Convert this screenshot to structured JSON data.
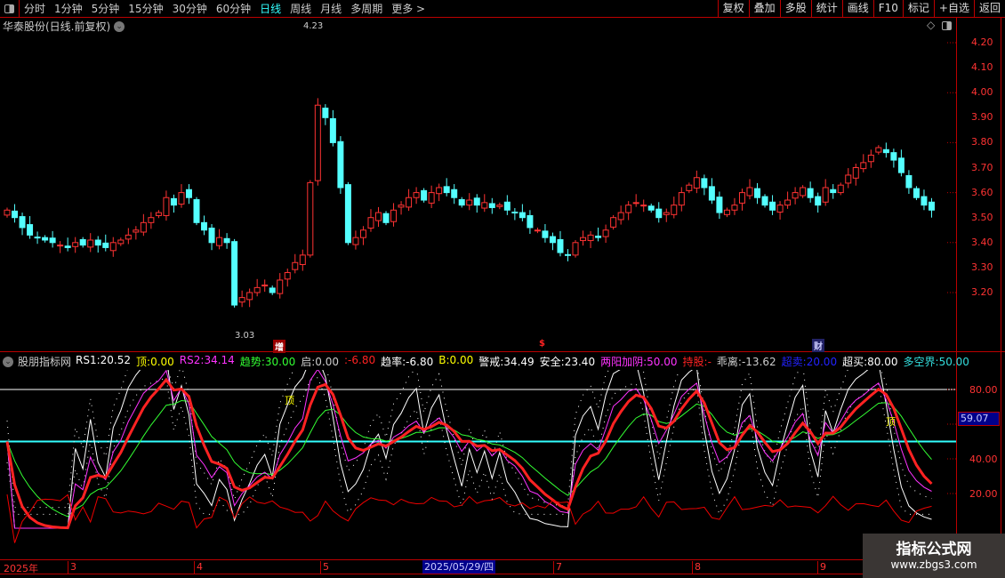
{
  "toolbar": {
    "periods": [
      "分时",
      "1分钟",
      "5分钟",
      "15分钟",
      "30分钟",
      "60分钟",
      "日线",
      "周线",
      "月线",
      "多周期",
      "更多 >"
    ],
    "active": "日线",
    "actions": [
      "复权",
      "叠加",
      "多股",
      "统计",
      "画线",
      "F10",
      "标记",
      "+自选",
      "返回"
    ]
  },
  "title": "华泰股份(日线.前复权)",
  "price_axis": [
    "4.20",
    "4.10",
    "4.00",
    "3.90",
    "3.80",
    "3.70",
    "3.60",
    "3.50",
    "3.40",
    "3.30",
    "3.20"
  ],
  "annotations": {
    "high": "4.23",
    "low": "3.03",
    "mark1": "增",
    "mark2": "$",
    "mark3": "财"
  },
  "indicator": {
    "name": "股朋指标网",
    "fields": [
      {
        "label": "RS1",
        "value": "20.52",
        "color": "#ffffff"
      },
      {
        "label": "顶",
        "value": "0.00",
        "color": "#ffff00"
      },
      {
        "label": "RS2",
        "value": "34.14",
        "color": "#ff33ff"
      },
      {
        "label": "趋势",
        "value": "30.00",
        "color": "#33ff33"
      },
      {
        "label": "启",
        "value": "0.00",
        "color": "#cccccc"
      },
      {
        "label": "",
        "value": "-6.80",
        "color": "#ff2222"
      },
      {
        "label": "趋率",
        "value": "-6.80",
        "color": "#ffffff"
      },
      {
        "label": "B",
        "value": "0.00",
        "color": "#ffff00"
      },
      {
        "label": "警戒",
        "value": "34.49",
        "color": "#ffffff"
      },
      {
        "label": "安全",
        "value": "23.40",
        "color": "#ffffff"
      },
      {
        "label": "两阳加阴",
        "value": "50.00",
        "color": "#ff33ff"
      },
      {
        "label": "持股",
        "value": "-",
        "color": "#ff2222"
      },
      {
        "label": "乖离",
        "value": "-13.62",
        "color": "#cccccc"
      },
      {
        "label": "超卖",
        "value": "20.00",
        "color": "#2222ff"
      },
      {
        "label": "超买",
        "value": "80.00",
        "color": "#ffffff"
      },
      {
        "label": "多空界",
        "value": "50.00",
        "color": "#33dddd"
      }
    ],
    "axis": [
      "80.00",
      "40.00",
      "20.00"
    ],
    "current": "59.07",
    "top_mark": "顶"
  },
  "dates": {
    "year": "2025年",
    "months": [
      "3",
      "4",
      "5",
      "7",
      "8",
      "9"
    ],
    "cursor": "2025/05/29/四"
  },
  "watermark": {
    "line1": "指标公式网",
    "line2": "www.zbgs3.com"
  },
  "colors": {
    "up": "#ff3333",
    "down": "#54ffff",
    "grid": "#bb0000"
  },
  "chart_data": {
    "type": "candlestick",
    "closes": [
      3.53,
      3.5,
      3.46,
      3.43,
      3.42,
      3.41,
      3.4,
      3.39,
      3.38,
      3.4,
      3.39,
      3.41,
      3.39,
      3.38,
      3.4,
      3.41,
      3.43,
      3.45,
      3.48,
      3.5,
      3.52,
      3.58,
      3.55,
      3.6,
      3.58,
      3.48,
      3.45,
      3.4,
      3.42,
      3.4,
      3.15,
      3.18,
      3.2,
      3.22,
      3.23,
      3.2,
      3.25,
      3.28,
      3.32,
      3.35,
      3.64,
      3.95,
      3.9,
      3.8,
      3.62,
      3.4,
      3.42,
      3.45,
      3.5,
      3.52,
      3.48,
      3.53,
      3.55,
      3.58,
      3.6,
      3.57,
      3.6,
      3.62,
      3.6,
      3.58,
      3.55,
      3.57,
      3.55,
      3.56,
      3.54,
      3.55,
      3.53,
      3.52,
      3.5,
      3.46,
      3.45,
      3.42,
      3.4,
      3.36,
      3.35,
      3.4,
      3.42,
      3.43,
      3.42,
      3.45,
      3.5,
      3.52,
      3.55,
      3.56,
      3.55,
      3.53,
      3.5,
      3.52,
      3.55,
      3.6,
      3.63,
      3.66,
      3.62,
      3.57,
      3.52,
      3.53,
      3.55,
      3.6,
      3.62,
      3.58,
      3.55,
      3.53,
      3.55,
      3.57,
      3.6,
      3.62,
      3.58,
      3.55,
      3.62,
      3.6,
      3.63,
      3.67,
      3.7,
      3.72,
      3.75,
      3.78,
      3.76,
      3.73,
      3.68,
      3.62,
      3.58,
      3.55,
      3.53
    ],
    "ylim": [
      3.03,
      4.23
    ],
    "indicator_ylim": [
      0,
      100
    ]
  }
}
